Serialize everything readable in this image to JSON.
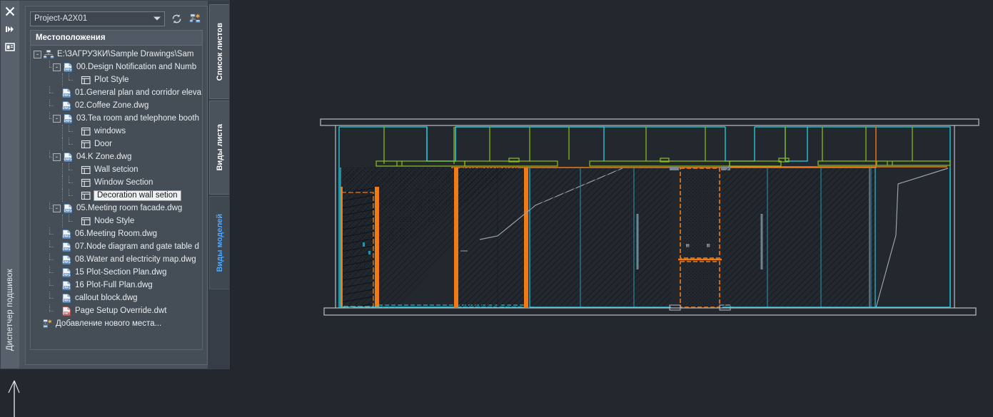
{
  "palette": {
    "title_vertical": "Диспетчер подшивок",
    "strip_icons": [
      {
        "name": "close-icon",
        "glyph": "✕"
      },
      {
        "name": "auto-hide-icon",
        "glyph": "▸"
      },
      {
        "name": "properties-icon",
        "glyph": "▤"
      }
    ],
    "sheetset_combo": {
      "value": "Project-A2X01",
      "placeholder": "Project-A2X01"
    },
    "toolbar": {
      "refresh_label": "refresh-sheet-status",
      "newsheet_label": "publish-sheet-set"
    },
    "group_header": "Местоположения",
    "tree": [
      {
        "label": "E:\\ЗАГРУЗКИ\\Sample Drawings\\Sam",
        "level": 0,
        "icon": "sheetset-icon",
        "expander": "-"
      },
      {
        "label": "00.Design Notification and Numb",
        "level": 1,
        "icon": "dwg-icon",
        "expander": "-"
      },
      {
        "label": "Plot Style",
        "level": 2,
        "icon": "view-icon",
        "expander": ""
      },
      {
        "label": "01.General plan and corridor eleva",
        "level": 1,
        "icon": "dwg-icon",
        "expander": ""
      },
      {
        "label": "02.Coffee Zone.dwg",
        "level": 1,
        "icon": "dwg-icon",
        "expander": ""
      },
      {
        "label": "03.Tea room and telephone booth",
        "level": 1,
        "icon": "dwg-icon",
        "expander": "-"
      },
      {
        "label": "windows",
        "level": 2,
        "icon": "view-icon",
        "expander": ""
      },
      {
        "label": "Door",
        "level": 2,
        "icon": "view-icon",
        "expander": ""
      },
      {
        "label": "04.K Zone.dwg",
        "level": 1,
        "icon": "dwg-icon",
        "expander": "-"
      },
      {
        "label": "Wall setcion",
        "level": 2,
        "icon": "view-icon",
        "expander": ""
      },
      {
        "label": "Window Section",
        "level": 2,
        "icon": "view-icon",
        "expander": ""
      },
      {
        "label": "Decoration wall setion",
        "level": 2,
        "icon": "view-icon",
        "expander": "",
        "editing": true
      },
      {
        "label": "05.Meeting room facade.dwg",
        "level": 1,
        "icon": "dwg-icon",
        "expander": "-"
      },
      {
        "label": "Node Style",
        "level": 2,
        "icon": "view-icon",
        "expander": ""
      },
      {
        "label": "06.Meeting Room.dwg",
        "level": 1,
        "icon": "dwg-icon",
        "expander": ""
      },
      {
        "label": "07.Node diagram and gate table d",
        "level": 1,
        "icon": "dwg-icon",
        "expander": ""
      },
      {
        "label": "08.Water and electricity map.dwg",
        "level": 1,
        "icon": "dwg-icon",
        "expander": ""
      },
      {
        "label": "15 Plot-Section Plan.dwg",
        "level": 1,
        "icon": "dwg-icon",
        "expander": ""
      },
      {
        "label": "16 Plot-Full Plan.dwg",
        "level": 1,
        "icon": "dwg-icon",
        "expander": ""
      },
      {
        "label": "callout block.dwg",
        "level": 1,
        "icon": "dwg-icon",
        "expander": ""
      },
      {
        "label": "Page Setup Override.dwt",
        "level": 1,
        "icon": "dwt-icon",
        "expander": ""
      },
      {
        "label": "Добавление нового места...",
        "level": 0,
        "icon": "add-location-icon",
        "expander": ""
      }
    ],
    "vertical_tabs": [
      {
        "label": "Список листов",
        "active": false
      },
      {
        "label": "Виды листа",
        "active": false
      },
      {
        "label": "Виды моделей",
        "active": true
      }
    ]
  },
  "canvas": {
    "name": "drawing-viewport",
    "background_color": "#23282f",
    "colors": {
      "cyan": "#25d3e8",
      "green": "#8ec11b",
      "orange": "#f07a14",
      "gray": "#b9bec4",
      "white": "#d8dde2",
      "teal": "#2a8fa8",
      "hatch": "#0d1016"
    }
  }
}
